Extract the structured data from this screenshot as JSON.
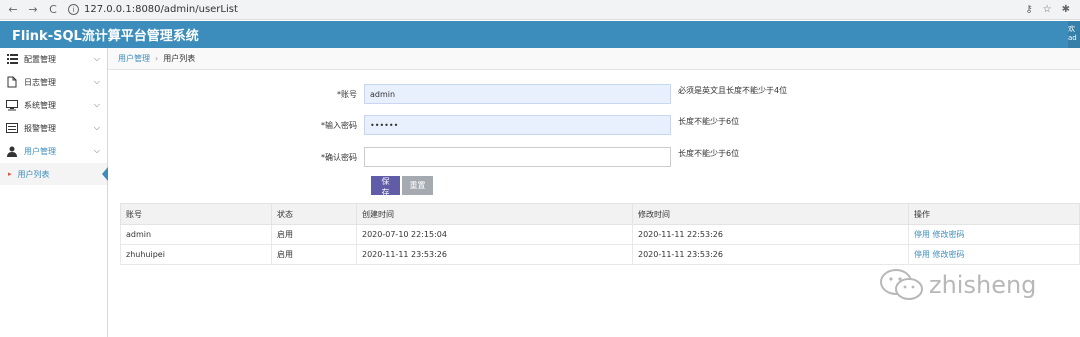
{
  "browser": {
    "url": "127.0.0.1:8080/admin/userList"
  },
  "header": {
    "app_title": "Flink-SQL流计算平台管理系统",
    "user_text": "欢 ad"
  },
  "sidebar": {
    "items": [
      {
        "label": "配置管理",
        "icon": "list-icon"
      },
      {
        "label": "日志管理",
        "icon": "file-icon"
      },
      {
        "label": "系统管理",
        "icon": "monitor-icon"
      },
      {
        "label": "报警管理",
        "icon": "alert-card-icon"
      },
      {
        "label": "用户管理",
        "icon": "user-icon"
      }
    ],
    "sub_item": "用户列表"
  },
  "breadcrumb": {
    "parent": "用户管理",
    "current": "用户列表"
  },
  "form": {
    "account_label": "*账号",
    "account_value": "admin",
    "account_hint": "必须是英文且长度不能少于4位",
    "password_label": "*输入密码",
    "password_value": "••••••",
    "password_hint": "长度不能少于6位",
    "confirm_label": "*确认密码",
    "confirm_value": "",
    "confirm_hint": "长度不能少于6位",
    "save_label": "保存",
    "reset_label": "重置"
  },
  "table": {
    "headers": [
      "账号",
      "状态",
      "创建时间",
      "修改时间",
      "操作"
    ],
    "rows": [
      {
        "account": "admin",
        "status": "启用",
        "created": "2020-07-10 22:15:04",
        "modified": "2020-11-11 22:53:26",
        "action1": "停用",
        "action2": "修改密码"
      },
      {
        "account": "zhuhuipei",
        "status": "启用",
        "created": "2020-11-11 23:53:26",
        "modified": "2020-11-11 23:53:26",
        "action1": "停用",
        "action2": "修改密码"
      }
    ]
  },
  "watermark": {
    "text": "zhisheng"
  },
  "colors": {
    "header": "#3c8dbc",
    "save_button": "#605ca8",
    "reset_button": "#a5a9b0",
    "link": "#3c8dbc"
  }
}
